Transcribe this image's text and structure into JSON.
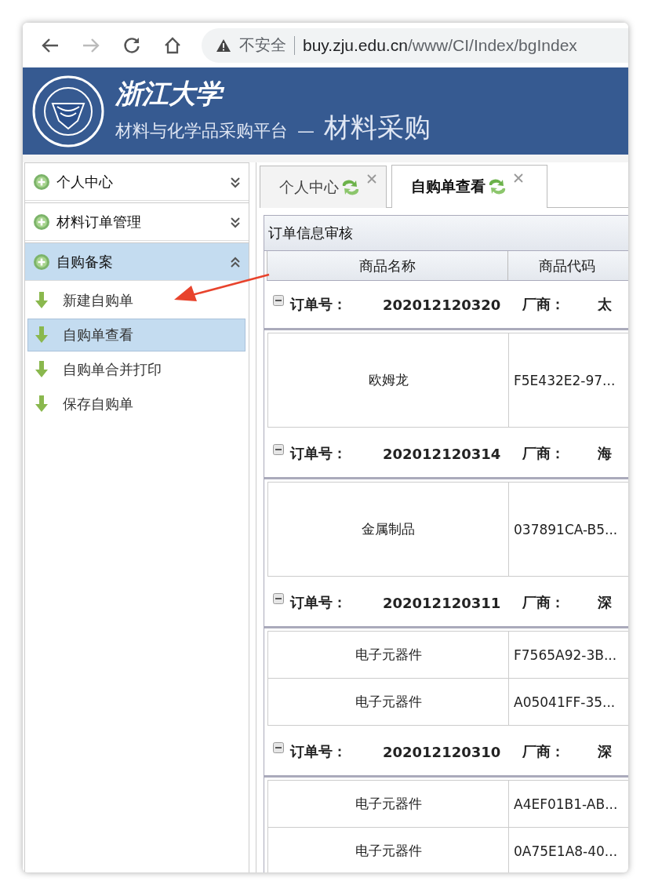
{
  "browser": {
    "back_enabled": true,
    "forward_enabled": false,
    "security": "不安全",
    "url_host": "buy.zju.edu.cn",
    "url_path": "/www/CI/Index/bgIndex"
  },
  "header": {
    "school": "浙江大学",
    "platform": "材料与化学品采购平台",
    "dash": "—",
    "module": "材料采购"
  },
  "sidebar": {
    "sections": [
      {
        "label": "个人中心",
        "expanded": false
      },
      {
        "label": "材料订单管理",
        "expanded": false
      },
      {
        "label": "自购备案",
        "expanded": true,
        "children": [
          {
            "label": "新建自购单",
            "selected": false
          },
          {
            "label": "自购单查看",
            "selected": true
          },
          {
            "label": "自购单合并打印",
            "selected": false
          },
          {
            "label": "保存自购单",
            "selected": false
          }
        ]
      }
    ]
  },
  "tabs": [
    {
      "label": "个人中心",
      "selected": false
    },
    {
      "label": "自购单查看",
      "selected": true
    }
  ],
  "panel": {
    "title": "订单信息审核",
    "table": {
      "columns": [
        "商品名称",
        "商品代码"
      ],
      "groups": [
        {
          "expanded": true,
          "order_label": "订单号：",
          "order_no": "202012120320",
          "vendor_label": "厂商：",
          "vendor": "太",
          "rows": [
            {
              "cells": [
                "欧姆龙",
                "F5E432E2-97..."
              ],
              "tall": true
            }
          ]
        },
        {
          "expanded": true,
          "order_label": "订单号：",
          "order_no": "202012120314",
          "vendor_label": "厂商：",
          "vendor": "海",
          "rows": [
            {
              "cells": [
                "金属制品",
                "037891CA-B5..."
              ],
              "tall": true
            }
          ]
        },
        {
          "expanded": true,
          "order_label": "订单号：",
          "order_no": "202012120311",
          "vendor_label": "厂商：",
          "vendor": "深",
          "rows": [
            {
              "cells": [
                "电子元器件",
                "F7565A92-3B..."
              ],
              "tall": false
            },
            {
              "cells": [
                "电子元器件",
                "A05041FF-35..."
              ],
              "tall": false
            }
          ]
        },
        {
          "expanded": true,
          "order_label": "订单号：",
          "order_no": "202012120310",
          "vendor_label": "厂商：",
          "vendor": "深",
          "rows": [
            {
              "cells": [
                "电子元器件",
                "A4EF01B1-AB..."
              ],
              "tall": false
            },
            {
              "cells": [
                "电子元器件",
                "0A75E1A8-40..."
              ],
              "tall": false
            }
          ]
        }
      ]
    }
  },
  "annotation": {
    "kind": "arrow"
  }
}
